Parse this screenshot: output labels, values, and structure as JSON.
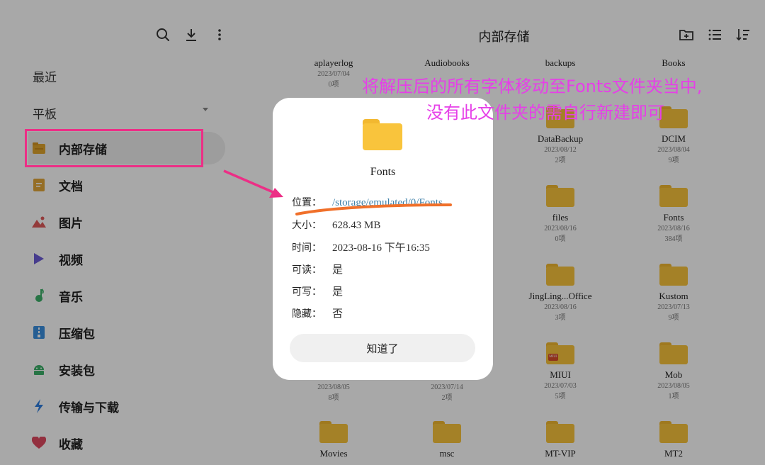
{
  "sidebar": {
    "sections": [
      "最近",
      "平板"
    ],
    "items": [
      {
        "label": "内部存储",
        "icon": "storage-folder-icon"
      },
      {
        "label": "文档",
        "icon": "document-icon"
      },
      {
        "label": "图片",
        "icon": "image-icon"
      },
      {
        "label": "视频",
        "icon": "video-play-icon"
      },
      {
        "label": "音乐",
        "icon": "music-note-icon"
      },
      {
        "label": "压缩包",
        "icon": "archive-icon"
      },
      {
        "label": "安装包",
        "icon": "android-icon"
      },
      {
        "label": "传输与下载",
        "icon": "transfer-lightning-icon"
      },
      {
        "label": "收藏",
        "icon": "heart-icon"
      }
    ],
    "top_icons": [
      "search-icon",
      "download-icon",
      "more-vertical-icon"
    ]
  },
  "main": {
    "title": "内部存储",
    "icons": [
      "new-folder-icon",
      "list-view-icon",
      "sort-icon"
    ],
    "files": [
      {
        "name": "aplayerlog",
        "date": "2023/07/04",
        "count": "0项"
      },
      {
        "name": "Audiobooks",
        "date": "",
        "count": ""
      },
      {
        "name": "backups",
        "date": "",
        "count": ""
      },
      {
        "name": "Books",
        "date": "",
        "count": ""
      },
      {
        "name": "DataBackup",
        "date": "2023/08/12",
        "count": "2项"
      },
      {
        "name": "DCIM",
        "date": "2023/08/04",
        "count": "9项"
      },
      {
        "name": "files",
        "date": "2023/08/16",
        "count": "0项"
      },
      {
        "name": "Fonts",
        "date": "2023/08/16",
        "count": "384项"
      },
      {
        "name": "JingLing...Office",
        "date": "2023/08/16",
        "count": "3项"
      },
      {
        "name": "Kustom",
        "date": "2023/07/13",
        "count": "9项"
      },
      {
        "name": "",
        "date": "2023/08/05",
        "count": "8项"
      },
      {
        "name": "",
        "date": "2023/07/14",
        "count": "2项"
      },
      {
        "name": "MIUI",
        "date": "2023/07/03",
        "count": "5项",
        "badge": "MIUI"
      },
      {
        "name": "Mob",
        "date": "2023/08/05",
        "count": "1项"
      },
      {
        "name": "Movies",
        "date": "",
        "count": ""
      },
      {
        "name": "msc",
        "date": "",
        "count": ""
      },
      {
        "name": "MT-VIP",
        "date": "",
        "count": ""
      },
      {
        "name": "MT2",
        "date": "",
        "count": ""
      }
    ]
  },
  "dialog": {
    "title": "Fonts",
    "rows": [
      {
        "key": "位置：",
        "value": "/storage/emulated/0/Fonts"
      },
      {
        "key": "大小：",
        "value": "628.43 MB"
      },
      {
        "key": "时间：",
        "value": "2023-08-16  下午16:35"
      },
      {
        "key": "可读：",
        "value": "是"
      },
      {
        "key": "可写：",
        "value": "是"
      },
      {
        "key": "隐藏：",
        "value": "否"
      }
    ],
    "ok_label": "知道了"
  },
  "annotation": {
    "line1": "将解压后的所有字体移动至Fonts文件夹当中,",
    "line2": "没有此文件夹的需自行新建即可",
    "color": "#e63fe8",
    "box_color": "#ec2f86",
    "underline_color": "#f0702a"
  },
  "colors": {
    "folder": "#f9c43c",
    "link": "#3c7fa8"
  }
}
